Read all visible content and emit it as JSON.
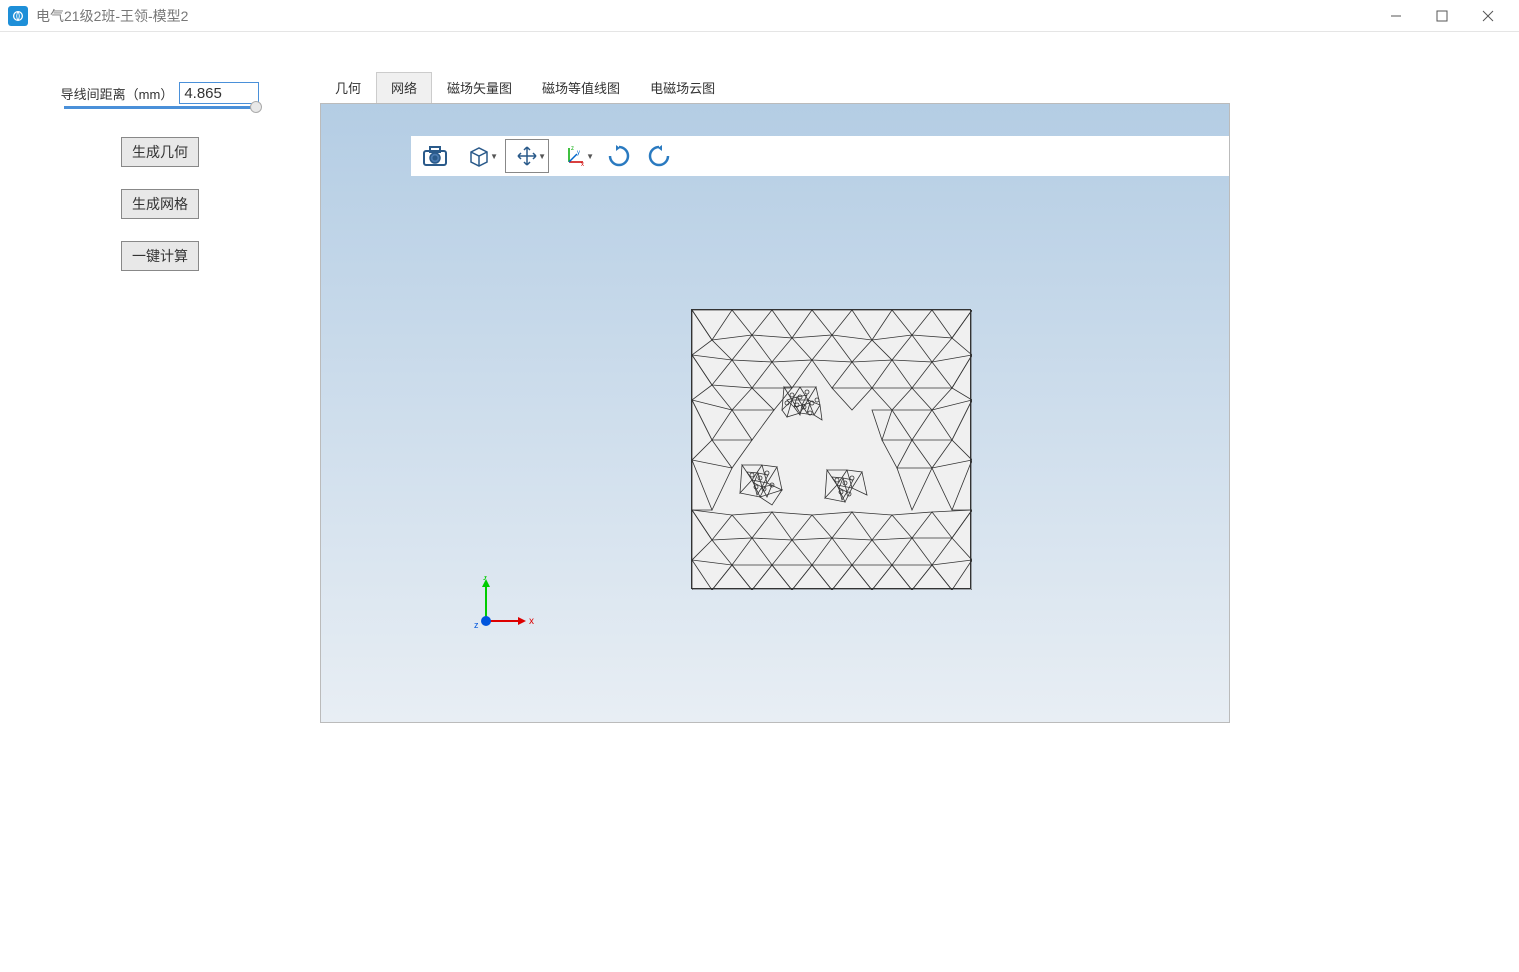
{
  "window": {
    "title": "电气21级2班-王领-模型2"
  },
  "sidebar": {
    "param_label": "导线间距离（mm）",
    "param_value": "4.865",
    "buttons": {
      "geometry": "生成几何",
      "mesh": "生成网格",
      "compute": "一键计算"
    }
  },
  "tabs": {
    "geometry": "几何",
    "mesh": "网络",
    "vector": "磁场矢量图",
    "contour": "磁场等值线图",
    "cloud": "电磁场云图",
    "active_index": 1
  },
  "axis": {
    "x_label": "x",
    "y_label": "y",
    "z_label": "z"
  },
  "toolbar_icons": {
    "camera": "camera-icon",
    "cube": "cube-icon",
    "pan": "pan-icon",
    "axis": "axis-orient-icon",
    "rotate_cw": "rotate-cw-icon",
    "rotate_ccw": "rotate-ccw-icon"
  }
}
